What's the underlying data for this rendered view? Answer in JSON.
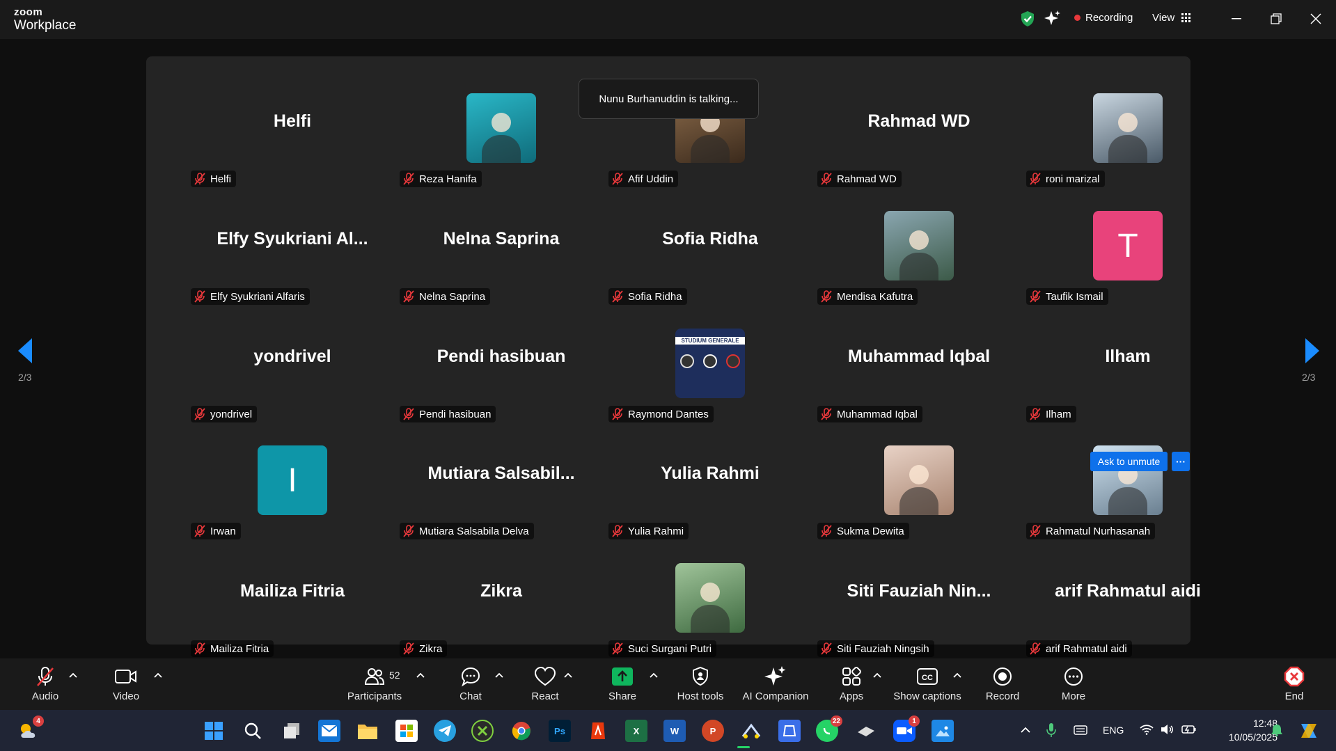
{
  "app": {
    "logo_line1": "zoom",
    "logo_line2": "Workplace",
    "recording_label": "Recording",
    "view_label": "View"
  },
  "talking_banner": "Nunu Burhanuddin is talking...",
  "pager": {
    "left": "2/3",
    "right": "2/3"
  },
  "participants": [
    {
      "display": "Helfi",
      "label": "Helfi",
      "type": "name"
    },
    {
      "display": "",
      "label": "Reza Hanifa",
      "type": "photo",
      "bg": "#2ab7c7"
    },
    {
      "display": "",
      "label": "Afif Uddin",
      "type": "photo",
      "bg": "#8a6a4a"
    },
    {
      "display": "Rahmad WD",
      "label": "Rahmad WD",
      "type": "name"
    },
    {
      "display": "",
      "label": "roni marizal",
      "type": "photo",
      "bg": "#8fa4b5"
    },
    {
      "display": "Elfy Syukriani Al...",
      "label": "Elfy Syukriani Alfaris",
      "type": "name"
    },
    {
      "display": "Nelna Saprina",
      "label": "Nelna Saprina",
      "type": "name"
    },
    {
      "display": "Sofia Ridha",
      "label": "Sofia Ridha",
      "type": "name"
    },
    {
      "display": "",
      "label": "Mendisa Kafutra",
      "type": "photo",
      "bg": "#5c7a6a"
    },
    {
      "display": "T",
      "label": "Taufik Ismail",
      "type": "letter",
      "bg": "#e8437b"
    },
    {
      "display": "yondrivel",
      "label": "yondrivel",
      "type": "name"
    },
    {
      "display": "Pendi hasibuan",
      "label": "Pendi hasibuan",
      "type": "name"
    },
    {
      "display": "STUDIUM GENERALE",
      "label": "Raymond Dantes",
      "type": "poster",
      "bg": "#1e2e5c"
    },
    {
      "display": "Muhammad Iqbal",
      "label": "Muhammad Iqbal",
      "type": "name"
    },
    {
      "display": "Ilham",
      "label": "Ilham",
      "type": "name"
    },
    {
      "display": "I",
      "label": "Irwan",
      "type": "letter",
      "bg": "#0e96a8"
    },
    {
      "display": "Mutiara  Salsabil...",
      "label": "Mutiara Salsabila Delva",
      "type": "name"
    },
    {
      "display": "Yulia Rahmi",
      "label": "Yulia Rahmi",
      "type": "name"
    },
    {
      "display": "",
      "label": "Sukma Dewita",
      "type": "photo",
      "bg": "#d8b8a8"
    },
    {
      "display": "",
      "label": "Rahmatul Nurhasanah",
      "type": "photo",
      "bg": "#a8c8e0"
    },
    {
      "display": "Mailiza Fitria",
      "label": "Mailiza Fitria",
      "type": "name"
    },
    {
      "display": "Zikra",
      "label": "Zikra",
      "type": "name"
    },
    {
      "display": "",
      "label": "Suci Surgani Putri",
      "type": "photo",
      "bg": "#6a9a5a"
    },
    {
      "display": "Siti  Fauziah  Nin...",
      "label": "Siti Fauziah Ningsih",
      "type": "name"
    },
    {
      "display": "arif Rahmatul aidi",
      "label": "arif Rahmatul aidi",
      "type": "name"
    }
  ],
  "hover": {
    "ask_unmute": "Ask to unmute",
    "more": "···"
  },
  "toolbar": {
    "audio": "Audio",
    "video": "Video",
    "participants": "Participants",
    "participants_count": "52",
    "chat": "Chat",
    "react": "React",
    "share": "Share",
    "host_tools": "Host tools",
    "ai_companion": "AI Companion",
    "apps": "Apps",
    "captions": "Show captions",
    "record": "Record",
    "more": "More",
    "end": "End"
  },
  "taskbar": {
    "weather_badge": "4",
    "whatsapp_badge": "22",
    "zoom_badge": "1",
    "lang": "ENG",
    "time": "12:48",
    "date": "10/05/2025"
  },
  "colors": {
    "accent": "#0e71eb",
    "recording_dot": "#e8383b",
    "muted_mic": "#e8383b",
    "share_green": "#0fb55d",
    "end_red": "#e8383b"
  }
}
